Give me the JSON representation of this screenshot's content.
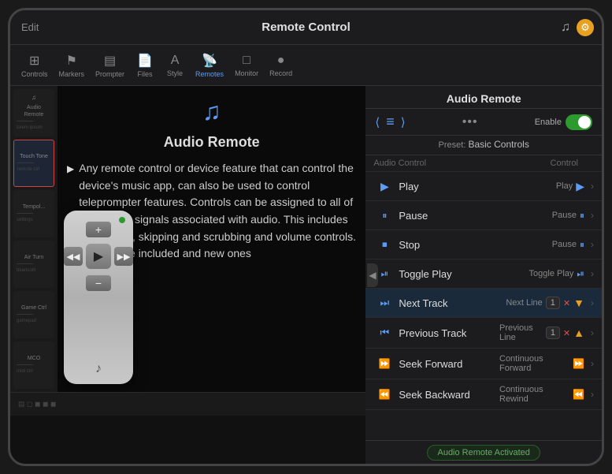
{
  "app": {
    "title": "Remote Control",
    "edit_label": "Edit"
  },
  "toolbar": {
    "items": [
      {
        "label": "Controls",
        "icon": "⊞",
        "active": false
      },
      {
        "label": "Markers",
        "icon": "⚑",
        "active": false
      },
      {
        "label": "Prompter",
        "icon": "▤",
        "active": false
      },
      {
        "label": "Files",
        "icon": "📄",
        "active": false
      },
      {
        "label": "Style",
        "icon": "A",
        "active": false
      },
      {
        "label": "Remotes",
        "icon": "📡",
        "active": true
      },
      {
        "label": "Monitor",
        "icon": "□",
        "active": false
      },
      {
        "label": "Record",
        "icon": "●",
        "active": false
      }
    ]
  },
  "right_panel": {
    "title": "Audio Remote",
    "enable_label": "Enable",
    "preset_label": "Preset: Basic Controls",
    "col_audio": "Audio Control",
    "col_control": "Control",
    "controls": [
      {
        "icon": "▶",
        "label": "Play",
        "control_label": "Play",
        "control_icon": "▶",
        "type": "play"
      },
      {
        "icon": "⏸",
        "label": "Pause",
        "control_label": "Pause",
        "control_icon": "⏸",
        "type": "pause"
      },
      {
        "icon": "⏹",
        "label": "Stop",
        "control_label": "Pause",
        "control_icon": "⏸",
        "type": "stop"
      },
      {
        "icon": "⏯",
        "label": "Toggle Play",
        "control_label": "Toggle Play",
        "control_icon": "▶⏸",
        "type": "toggle"
      },
      {
        "icon": "⏭",
        "label": "Next Track",
        "control_label": "Next Line",
        "num": "1",
        "type": "next",
        "highlighted": true
      },
      {
        "icon": "⏮",
        "label": "Previous Track",
        "control_label": "Previous Line",
        "num": "1",
        "type": "prev"
      },
      {
        "icon": "⏩",
        "label": "Seek Forward",
        "control_label": "Continuous Forward",
        "control_icon": "⏩",
        "type": "seek_fwd"
      },
      {
        "icon": "⏪",
        "label": "Seek Backward",
        "control_label": "Continuous Rewind",
        "control_icon": "⏪",
        "type": "seek_bwd"
      }
    ]
  },
  "doc": {
    "title": "Audio Remote",
    "music_icon": "♫",
    "body_text": "Any remote control or device feature that can control the device's music app, can also be used to control teleprompter features. Controls can be assigned to all of the remote signals associated with audio. This includes play/pause, skipping and scrubbing and volume controls. Presets are included and new ones",
    "status": "Audio Remote Activated"
  },
  "remote_widget": {
    "plus": "+",
    "minus": "−",
    "play": "▶",
    "rewind": "◀◀",
    "forward": "▶▶",
    "music": "♪"
  }
}
